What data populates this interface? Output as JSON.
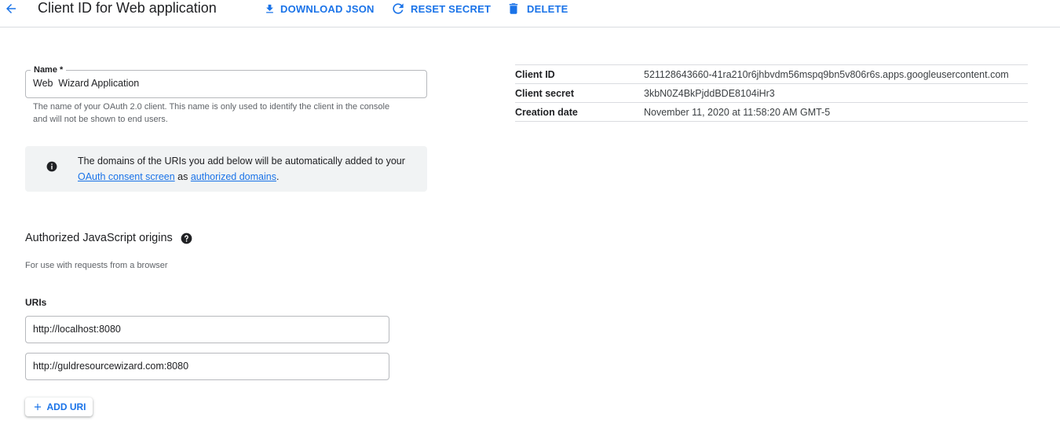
{
  "header": {
    "title": "Client ID for Web application",
    "download_json": "DOWNLOAD JSON",
    "reset_secret": "RESET SECRET",
    "delete": "DELETE",
    "icons": {
      "back": "arrow-back-icon",
      "download": "download-icon",
      "reset": "refresh-icon",
      "delete": "trash-icon"
    }
  },
  "name_field": {
    "label": "Name *",
    "value": "Web  Wizard Application",
    "help": "The name of your OAuth 2.0 client. This name is only used to identify the client in the console and will not be shown to end users."
  },
  "info_box": {
    "text_before": "The domains of the URIs you add below will be automatically added to your ",
    "link1": "OAuth consent screen",
    "text_middle": " as ",
    "link2": "authorized domains",
    "text_after": "."
  },
  "origins": {
    "title": "Authorized JavaScript origins",
    "subtitle": "For use with requests from a browser",
    "uris_label": "URIs",
    "uris": [
      "http://localhost:8080",
      "http://guldresourcewizard.com:8080"
    ],
    "add_uri": "ADD URI"
  },
  "properties": [
    {
      "key": "Client ID",
      "value": "521128643660-41ra210r6jhbvdm56mspq9bn5v806r6s.apps.googleusercontent.com"
    },
    {
      "key": "Client secret",
      "value": "3kbN0Z4BkPjddBDE8104iHr3"
    },
    {
      "key": "Creation date",
      "value": "November 11, 2020 at 11:58:20 AM GMT-5"
    }
  ],
  "colors": {
    "accent": "#1a73e8",
    "text": "#202124",
    "muted": "#5f6368",
    "divider": "#dadce0",
    "info_bg": "#f1f3f4"
  }
}
